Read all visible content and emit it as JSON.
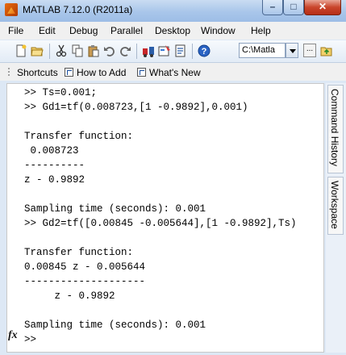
{
  "window": {
    "title": "MATLAB  7.12.0 (R2011a)"
  },
  "menu": [
    "File",
    "Edit",
    "Debug",
    "Parallel",
    "Desktop",
    "Window",
    "Help"
  ],
  "toolbar": {
    "current_dir": "C:\\Matla",
    "browse_label": "..."
  },
  "shortcuts": {
    "label": "Shortcuts",
    "how_to_add": "How to Add",
    "whats_new": "What's New"
  },
  "command_window": {
    "lines": [
      ">> Ts=0.001;",
      ">> Gd1=tf(0.008723,[1 -0.9892],0.001)",
      "",
      "Transfer function:",
      " 0.008723",
      "----------",
      "z - 0.9892",
      "",
      "Sampling time (seconds): 0.001",
      ">> Gd2=tf([0.00845 -0.005644],[1 -0.9892],Ts)",
      "",
      "Transfer function:",
      "0.00845 z - 0.005644",
      "--------------------",
      "     z - 0.9892",
      "",
      "Sampling time (seconds): 0.001",
      ">> "
    ],
    "fx_symbol": "fx"
  },
  "side_tabs": [
    "Command History",
    "Workspace"
  ]
}
